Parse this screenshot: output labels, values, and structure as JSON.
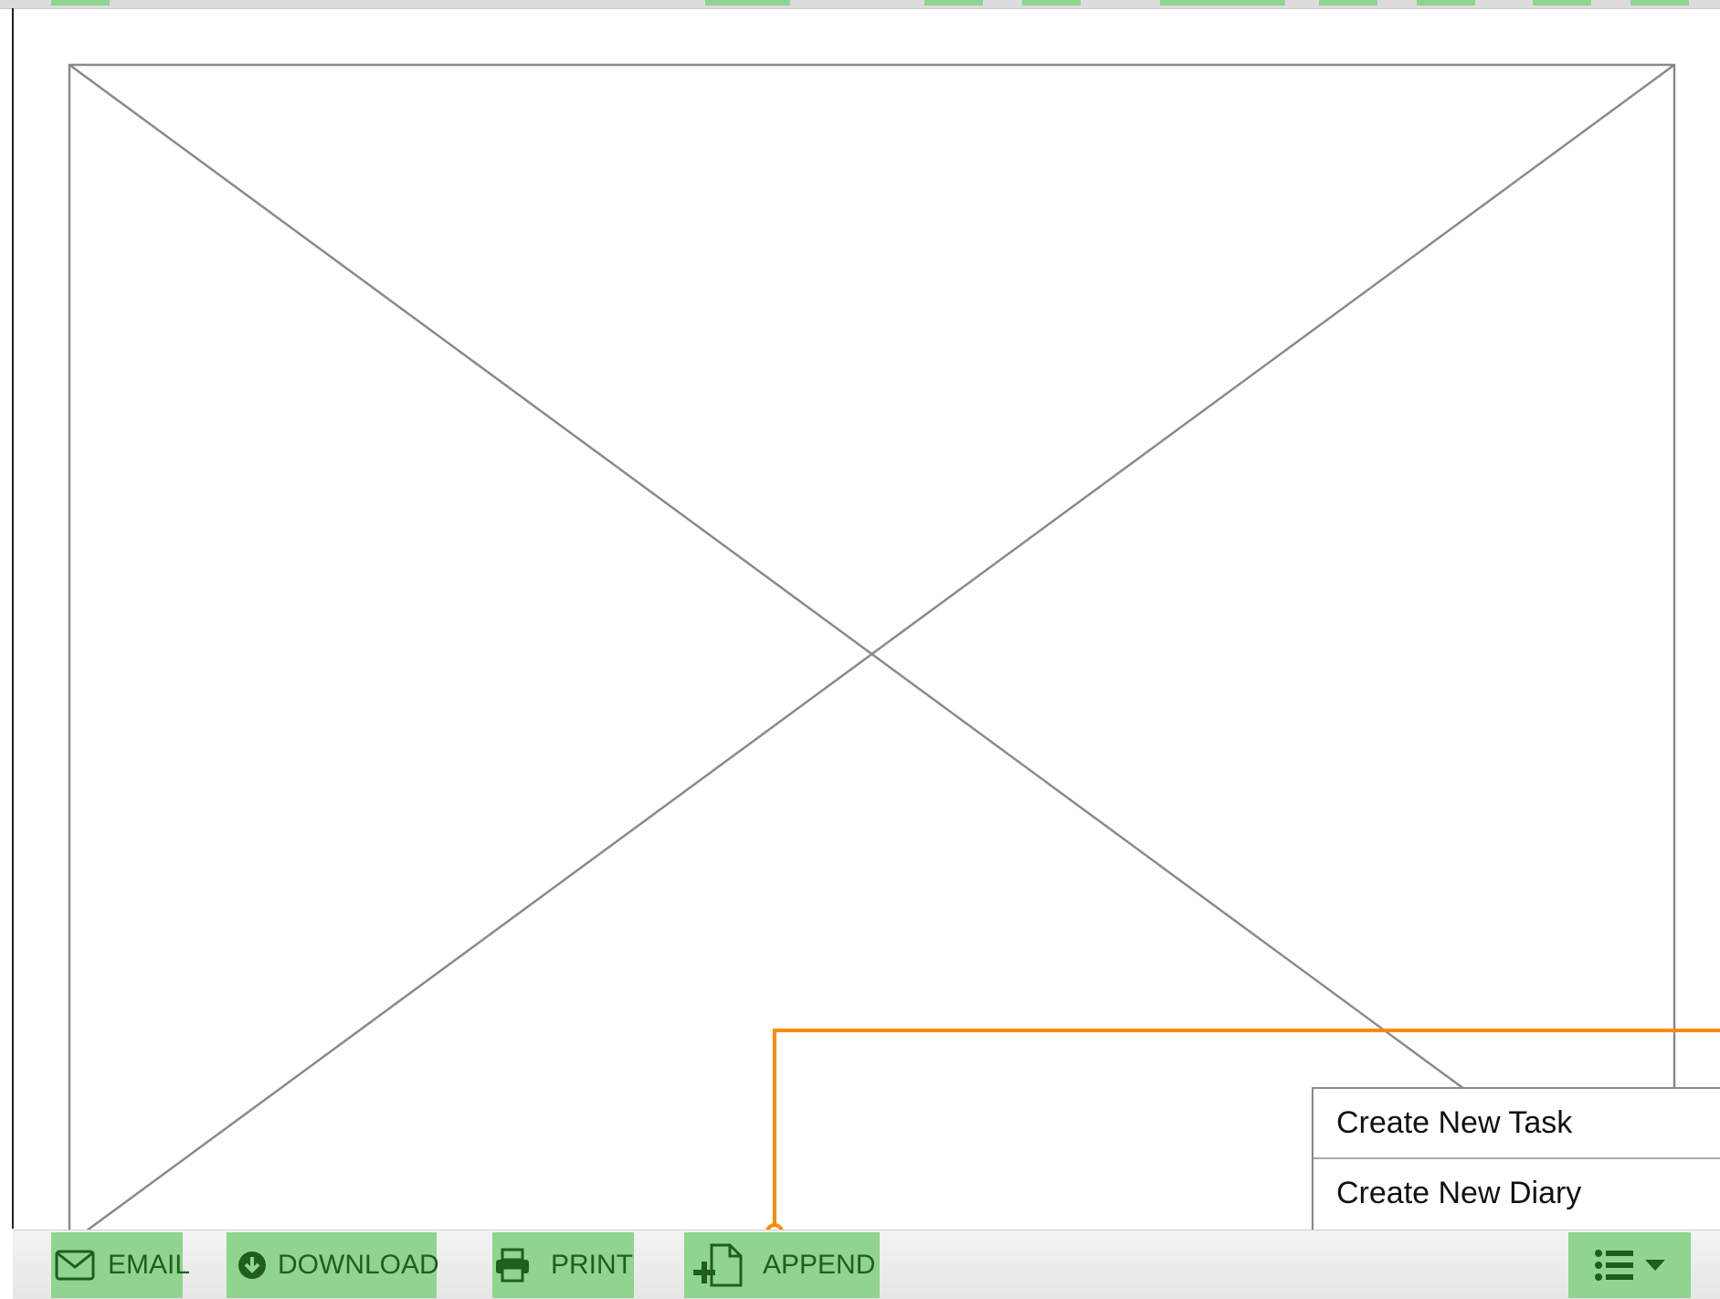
{
  "toolbar": {
    "email_label": "EMAIL",
    "download_label": "DOWNLOAD",
    "print_label": "PRINT",
    "append_label": "APPEND"
  },
  "menu": {
    "items": [
      {
        "label": "Create New Task"
      },
      {
        "label": "Create New Diary"
      }
    ]
  },
  "icons": {
    "email": "envelope-icon",
    "download": "download-circle-icon",
    "print": "printer-icon",
    "append": "append-document-icon",
    "menu": "list-icon",
    "menu_caret": "caret-down-icon"
  },
  "colors": {
    "button_green": "#8fd48f",
    "button_text": "#1f5e1f",
    "callout_orange": "#ff8a00",
    "placeholder_gray": "#8a8a8a"
  }
}
